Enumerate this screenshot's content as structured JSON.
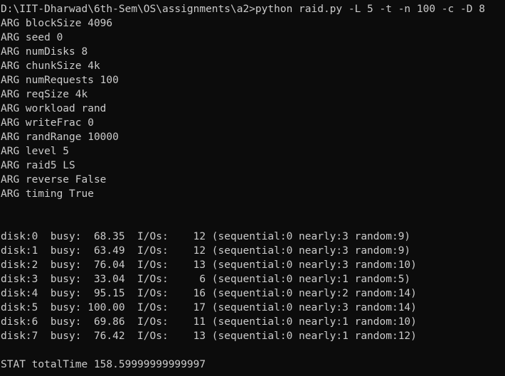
{
  "command_line": "D:\\IIT-Dharwad\\6th-Sem\\OS\\assignments\\a2>python raid.py -L 5 -t -n 100 -c -D 8",
  "args": [
    "ARG blockSize 4096",
    "ARG seed 0",
    "ARG numDisks 8",
    "ARG chunkSize 4k",
    "ARG numRequests 100",
    "ARG reqSize 4k",
    "ARG workload rand",
    "ARG writeFrac 0",
    "ARG randRange 10000",
    "ARG level 5",
    "ARG raid5 LS",
    "ARG reverse False",
    "ARG timing True"
  ],
  "disks": [
    "disk:0  busy:  68.35  I/Os:    12 (sequential:0 nearly:3 random:9)",
    "disk:1  busy:  63.49  I/Os:    12 (sequential:0 nearly:3 random:9)",
    "disk:2  busy:  76.04  I/Os:    13 (sequential:0 nearly:3 random:10)",
    "disk:3  busy:  33.04  I/Os:     6 (sequential:0 nearly:1 random:5)",
    "disk:4  busy:  95.15  I/Os:    16 (sequential:0 nearly:2 random:14)",
    "disk:5  busy: 100.00  I/Os:    17 (sequential:0 nearly:3 random:14)",
    "disk:6  busy:  69.86  I/Os:    11 (sequential:0 nearly:1 random:10)",
    "disk:7  busy:  76.42  I/Os:    13 (sequential:0 nearly:1 random:12)"
  ],
  "stat_line": "STAT totalTime 158.59999999999997",
  "colors": {
    "background": "#0c0c0c",
    "foreground": "#cccccc"
  }
}
